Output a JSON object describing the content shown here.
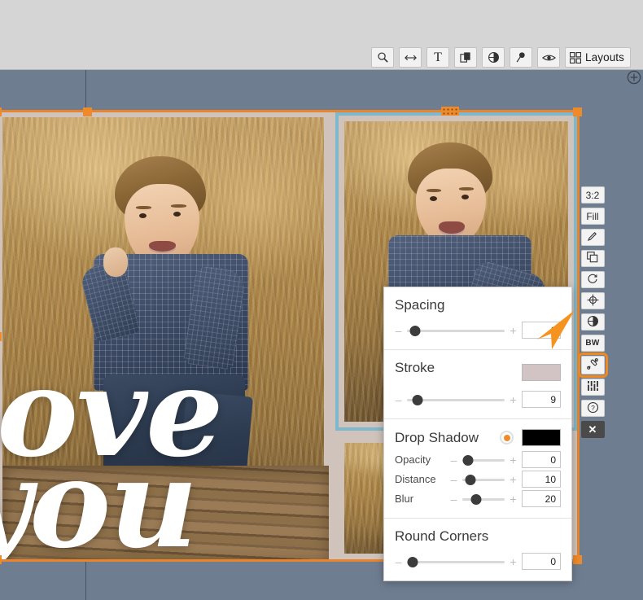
{
  "app": {
    "canvas_background": "#6f7d91",
    "chrome_background": "#d5d5d5",
    "accent_orange": "#ef8a2b",
    "selection_stroke": "#7fb8cd"
  },
  "toolbar": {
    "items": [
      {
        "name": "zoom-tool",
        "icon": "magnifier-icon",
        "label": ""
      },
      {
        "name": "spread-tool",
        "icon": "arrows-horizontal-icon",
        "label": ""
      },
      {
        "name": "text-tool",
        "icon": "text-t-icon",
        "label": ""
      },
      {
        "name": "background-tool",
        "icon": "layers-icon",
        "label": ""
      },
      {
        "name": "filter-tool",
        "icon": "contrast-circle-icon",
        "label": ""
      },
      {
        "name": "pin-tool",
        "icon": "pin-icon",
        "label": ""
      },
      {
        "name": "preview-tool",
        "icon": "eye-icon",
        "label": ""
      },
      {
        "name": "layouts-button",
        "icon": "grid-squares-icon",
        "label": "Layouts"
      }
    ]
  },
  "add_page": {
    "label": "",
    "icon": "plus-circle-icon"
  },
  "spread": {
    "photos": [
      {
        "name": "photo-left-boy-on-crate",
        "caption": ""
      },
      {
        "name": "photo-top-right-boy-smiling",
        "caption": ""
      },
      {
        "name": "photo-bottom-right-boy-seated",
        "caption": ""
      }
    ],
    "overlay_text": {
      "line1": "love",
      "line2": "you"
    }
  },
  "side_tools": {
    "items": [
      {
        "name": "aspect-ratio-button",
        "label": "3:2",
        "icon": "",
        "active": false
      },
      {
        "name": "fill-button",
        "label": "Fill",
        "icon": "",
        "active": false
      },
      {
        "name": "edit-pencil-button",
        "label": "",
        "icon": "pencil-icon",
        "active": false
      },
      {
        "name": "duplicate-button",
        "label": "",
        "icon": "copy-layers-icon",
        "active": false
      },
      {
        "name": "rotate-button",
        "label": "",
        "icon": "rotate-icon",
        "active": false
      },
      {
        "name": "center-align-button",
        "label": "",
        "icon": "crosshair-grid-icon",
        "active": false
      },
      {
        "name": "contrast-button",
        "label": "",
        "icon": "contrast-circle-icon",
        "active": false
      },
      {
        "name": "black-white-button",
        "label": "BW",
        "icon": "",
        "active": false
      },
      {
        "name": "style-brush-button",
        "label": "",
        "icon": "brush-bone-icon",
        "active": true
      },
      {
        "name": "adjust-sliders-button",
        "label": "",
        "icon": "sliders-icon",
        "active": false
      },
      {
        "name": "help-button",
        "label": "",
        "icon": "question-circle-icon",
        "active": false
      },
      {
        "name": "close-button",
        "label": "✕",
        "icon": "close-x-icon",
        "active": false
      }
    ]
  },
  "properties_panel": {
    "spacing": {
      "title": "Spacing",
      "value": "6",
      "knob_percent": 8,
      "minus": "–",
      "plus": "+"
    },
    "stroke": {
      "title": "Stroke",
      "value": "9",
      "knob_percent": 11,
      "color": "#d2c4c4",
      "minus": "–",
      "plus": "+"
    },
    "drop_shadow": {
      "title": "Drop Shadow",
      "enabled": true,
      "color": "#000000",
      "rows": [
        {
          "label": "Opacity",
          "value": "0",
          "knob_percent": 13
        },
        {
          "label": "Distance",
          "value": "10",
          "knob_percent": 20
        },
        {
          "label": "Blur",
          "value": "20",
          "knob_percent": 32
        }
      ],
      "minus": "–",
      "plus": "+"
    },
    "round_corners": {
      "title": "Round Corners",
      "value": "0",
      "knob_percent": 6,
      "minus": "–",
      "plus": "+"
    }
  }
}
